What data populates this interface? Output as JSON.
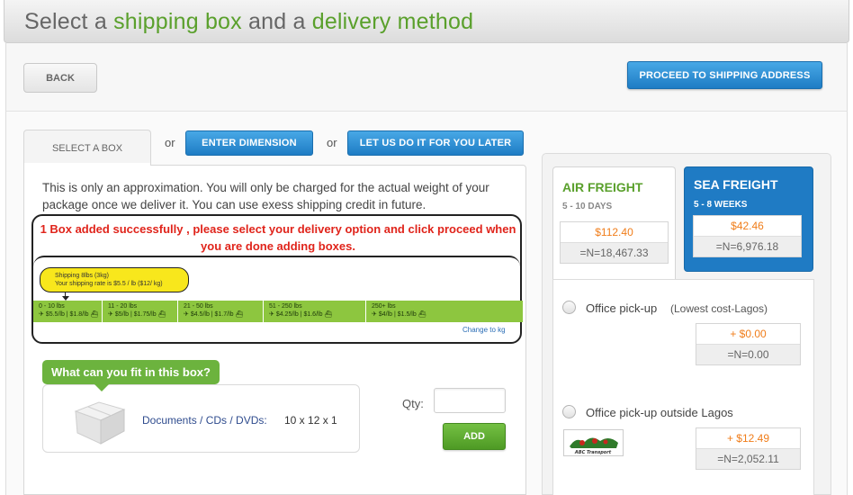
{
  "header": {
    "title_part1": "Select a ",
    "title_highlight1": "shipping box",
    "title_part2": " and a ",
    "title_highlight2": "delivery method"
  },
  "toolbar": {
    "back_label": "BACK",
    "proceed_label": "PROCEED TO SHIPPING ADDRESS"
  },
  "box_tabs": {
    "select_box": "SELECT A BOX",
    "or1": "or",
    "enter_dimension": "ENTER DIMENSION",
    "or2": "or",
    "let_us_do_it": "LET US DO IT FOR YOU LATER"
  },
  "approximation_text": "This is only an approximation. You will only be charged for the actual weight of your package once we deliver it. You can use exess shipping credit in future.",
  "success_message": "1 Box added successfully , please select your delivery option and click proceed when you are done adding boxes.",
  "rate_bubble": {
    "line1": "Shipping 8lbs (3kg)",
    "line2": "Your shipping rate is $5.5 / lb ($12/ kg)"
  },
  "tiers": [
    {
      "range": "0 - 10 lbs",
      "rate": "$5.5/lb | $1.8/lb"
    },
    {
      "range": "11 - 20 lbs",
      "rate": "$5/lb | $1.75/lb"
    },
    {
      "range": "21 - 50 lbs",
      "rate": "$4.5/lb | $1.7/lb"
    },
    {
      "range": "51 - 250 lbs",
      "rate": "$4.25/lb | $1.6/lb"
    },
    {
      "range": "250+ lbs",
      "rate": "$4/lb | $1.5/lb"
    }
  ],
  "change_unit_link": "Change to kg",
  "fit": {
    "banner": "What can you fit in this box?",
    "item_label": "Documents / CDs / DVDs:",
    "item_size": "10 x 12 x 1"
  },
  "qty": {
    "label": "Qty:",
    "value": "",
    "add_label": "ADD"
  },
  "freight": {
    "air": {
      "title": "AIR FREIGHT",
      "days": "5 - 10 DAYS",
      "usd": "$112.40",
      "ngn": "=N=18,467.33",
      "color": "#5aa02c"
    },
    "sea": {
      "title": "SEA FREIGHT",
      "days": "5 - 8 WEEKS",
      "usd": "$42.46",
      "ngn": "=N=6,976.18",
      "color": "#1f7bc4"
    }
  },
  "delivery_options": [
    {
      "label": "Office pick-up",
      "note": "(Lowest cost-Lagos)",
      "usd": "+ $0.00",
      "ngn": "=N=0.00"
    },
    {
      "label": "Office pick-up outside Lagos",
      "note": "",
      "usd": "+ $12.49",
      "ngn": "=N=2,052.11",
      "logo_text": "ABC Transport"
    }
  ],
  "colors": {
    "accent_green": "#5aa02c",
    "button_blue": "#1e7cc4",
    "error_red": "#e0241b",
    "price_orange": "#f07d1a",
    "tier_green": "#8dc63f"
  }
}
